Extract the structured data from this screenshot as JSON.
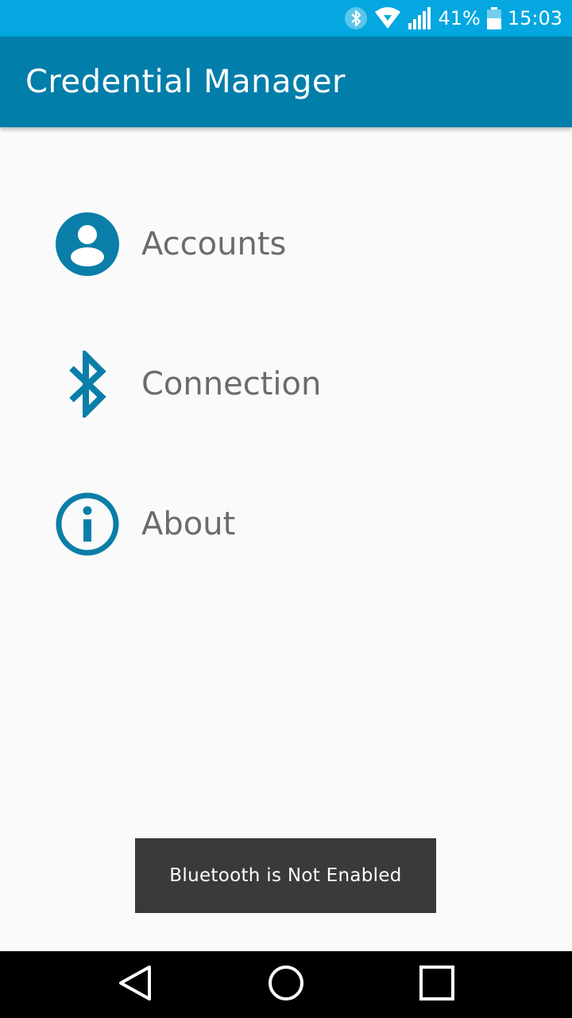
{
  "status_bar": {
    "battery_percent": "41%",
    "time": "15:03",
    "icons": [
      "bluetooth-icon",
      "wifi-icon",
      "signal-icon",
      "battery-icon"
    ]
  },
  "app_bar": {
    "title": "Credential Manager"
  },
  "menu": {
    "items": [
      {
        "label": "Accounts",
        "icon": "account-icon"
      },
      {
        "label": "Connection",
        "icon": "bluetooth-icon"
      },
      {
        "label": "About",
        "icon": "info-icon"
      }
    ]
  },
  "toast": {
    "message": "Bluetooth is Not Enabled"
  },
  "nav_bar": {
    "buttons": [
      "back-icon",
      "home-icon",
      "recents-icon"
    ]
  },
  "colors": {
    "status_bar": "#04a7e0",
    "app_bar": "#027eaa",
    "accent": "#0a7ea8",
    "menu_text": "#6b6b6b",
    "toast_bg": "#3a3a3a",
    "nav_bar": "#000000"
  }
}
